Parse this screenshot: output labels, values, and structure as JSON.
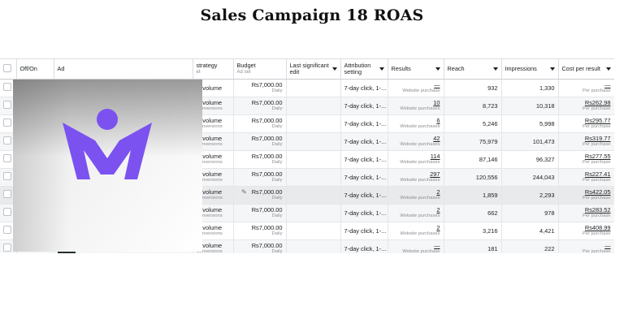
{
  "title": "Sales Campaign 18 ROAS",
  "columns": {
    "off_on": "Off/On",
    "ad": "Ad",
    "strategy": "strategy",
    "strategy_sub": "et",
    "budget": "Budget",
    "budget_sub": "Ad set",
    "last_edit": "Last significant edit",
    "attribution": "Attribution setting",
    "results": "Results",
    "reach": "Reach",
    "impressions": "Impressions",
    "cost_per_result": "Cost per result"
  },
  "rows": [
    {
      "strategy": "st volume",
      "strategy_sub": "",
      "budget": "Rs7,000.00",
      "budget_sub": "Daily",
      "attribution": "7-day click, 1-...",
      "results": "—",
      "results_sub": "Website purchase",
      "reach": "932",
      "impressions": "1,330",
      "cost": "—",
      "cost_sub": "Per purchase"
    },
    {
      "strategy": "st volume",
      "strategy_sub": "Conversions",
      "budget": "Rs7,000.00",
      "budget_sub": "Daily",
      "attribution": "7-day click, 1-...",
      "results": "10",
      "results_sub": "Website purchases",
      "reach": "8,723",
      "impressions": "10,318",
      "cost": "Rs262.98",
      "cost_sub": "Per purchase"
    },
    {
      "strategy": "st volume",
      "strategy_sub": "Conversions",
      "budget": "Rs7,000.00",
      "budget_sub": "Daily",
      "attribution": "7-day click, 1-...",
      "results": "6",
      "results_sub": "Website purchases",
      "reach": "5,246",
      "impressions": "5,998",
      "cost": "Rs295.77",
      "cost_sub": "Per purchase"
    },
    {
      "strategy": "st volume",
      "strategy_sub": "Conversions",
      "budget": "Rs7,000.00",
      "budget_sub": "Daily",
      "attribution": "7-day click, 1-...",
      "results": "42",
      "results_sub": "Website purchases",
      "reach": "75,979",
      "impressions": "101,473",
      "cost": "Rs319.77",
      "cost_sub": "Per purchase"
    },
    {
      "strategy": "st volume",
      "strategy_sub": "Conversions",
      "budget": "Rs7,000.00",
      "budget_sub": "Daily",
      "attribution": "7-day click, 1-...",
      "results": "114",
      "results_sub": "Website purchases",
      "reach": "87,146",
      "impressions": "96,327",
      "cost": "Rs277.55",
      "cost_sub": "Per purchase"
    },
    {
      "strategy": "st volume",
      "strategy_sub": "Conversions",
      "budget": "Rs7,000.00",
      "budget_sub": "Daily",
      "attribution": "7-day click, 1-...",
      "results": "297",
      "results_sub": "Website purchases",
      "reach": "120,556",
      "impressions": "244,043",
      "cost": "Rs227.41",
      "cost_sub": "Per purchase"
    },
    {
      "strategy": "st volume",
      "strategy_sub": "Conversions",
      "budget": "Rs7,000.00",
      "budget_sub": "Daily",
      "attribution": "7-day click, 1-...",
      "results": "2",
      "results_sub": "Website purchases",
      "reach": "1,859",
      "impressions": "2,293",
      "cost": "Rs422.05",
      "cost_sub": "Per purchase"
    },
    {
      "strategy": "st volume",
      "strategy_sub": "Conversions",
      "budget": "Rs7,000.00",
      "budget_sub": "Daily",
      "attribution": "7-day click, 1-...",
      "results": "2",
      "results_sub": "Website purchases",
      "reach": "662",
      "impressions": "978",
      "cost": "Rs283.52",
      "cost_sub": "Per purchase"
    },
    {
      "strategy": "st volume",
      "strategy_sub": "Conversions",
      "budget": "Rs7,000.00",
      "budget_sub": "Daily",
      "attribution": "7-day click, 1-...",
      "results": "2",
      "results_sub": "Website purchases",
      "reach": "3,216",
      "impressions": "4,421",
      "cost": "Rs408.99",
      "cost_sub": "Per purchase"
    },
    {
      "strategy": "st volume",
      "strategy_sub": "Conversions",
      "budget": "Rs7,000.00",
      "budget_sub": "Daily",
      "attribution": "7-day click, 1-...",
      "results": "—",
      "results_sub": "Website purchase",
      "reach": "181",
      "impressions": "222",
      "cost": "—",
      "cost_sub": "Per purchase"
    }
  ],
  "overlay": {
    "logo_icon": "m-person-logo-icon",
    "logo_color": "#7b52f0"
  },
  "colors": {
    "header_border": "#c9ccd1",
    "row_alt": "#f5f6f7",
    "row_highlight": "#e9eaec"
  }
}
